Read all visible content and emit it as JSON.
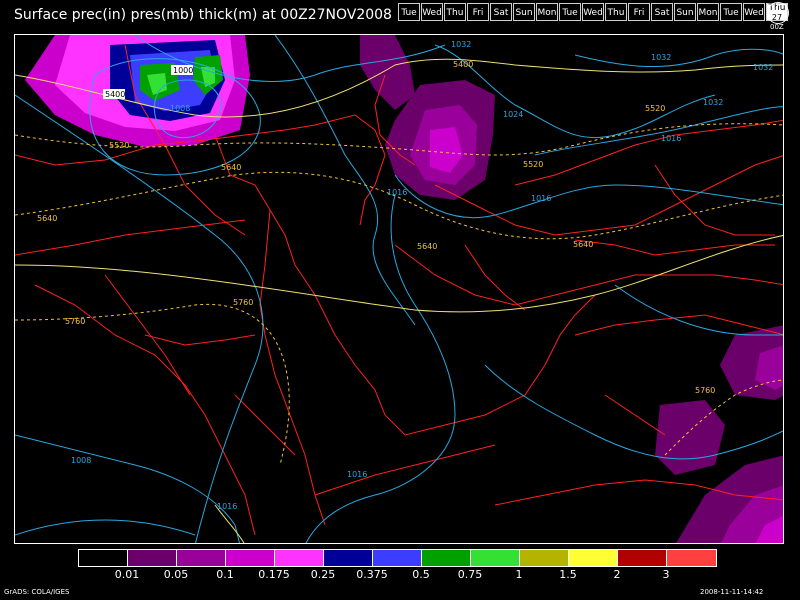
{
  "title": "Surface prec(in) pres(mb) thick(m) at 00Z27NOV2008",
  "days": [
    "Tue",
    "Wed",
    "Thu",
    "Fri",
    "Sat",
    "Sun",
    "Mon",
    "Tue",
    "Wed",
    "Thu",
    "Fri",
    "Sat",
    "Sun",
    "Mon",
    "Tue",
    "Wed"
  ],
  "current_day": {
    "label": "Thu",
    "num": "27"
  },
  "clock_label": "00Z",
  "colorbar": {
    "colors": [
      "#000000",
      "#6b006b",
      "#9a009a",
      "#cc00cc",
      "#ff33ff",
      "#000099",
      "#3d3dff",
      "#00a000",
      "#33e033",
      "#b4b400",
      "#ffff33",
      "#b00000",
      "#ff4040"
    ],
    "labels": [
      "0.01",
      "0.05",
      "0.1",
      "0.175",
      "0.25",
      "0.375",
      "0.5",
      "0.75",
      "1",
      "1.5",
      "2",
      "3"
    ]
  },
  "isobar_labels": [
    "1032",
    "1000",
    "1008",
    "1032",
    "1032",
    "1024",
    "1032",
    "1016",
    "1016",
    "1016",
    "1008",
    "1016",
    "1016"
  ],
  "thickness_labels": [
    "5400",
    "5400",
    "5520",
    "5520",
    "5520",
    "5640",
    "5640",
    "5640",
    "5640",
    "5760",
    "5760",
    "5760"
  ],
  "footer_left": "GrADS: COLA/IGES",
  "footer_right": "2008-11-11-14:42"
}
